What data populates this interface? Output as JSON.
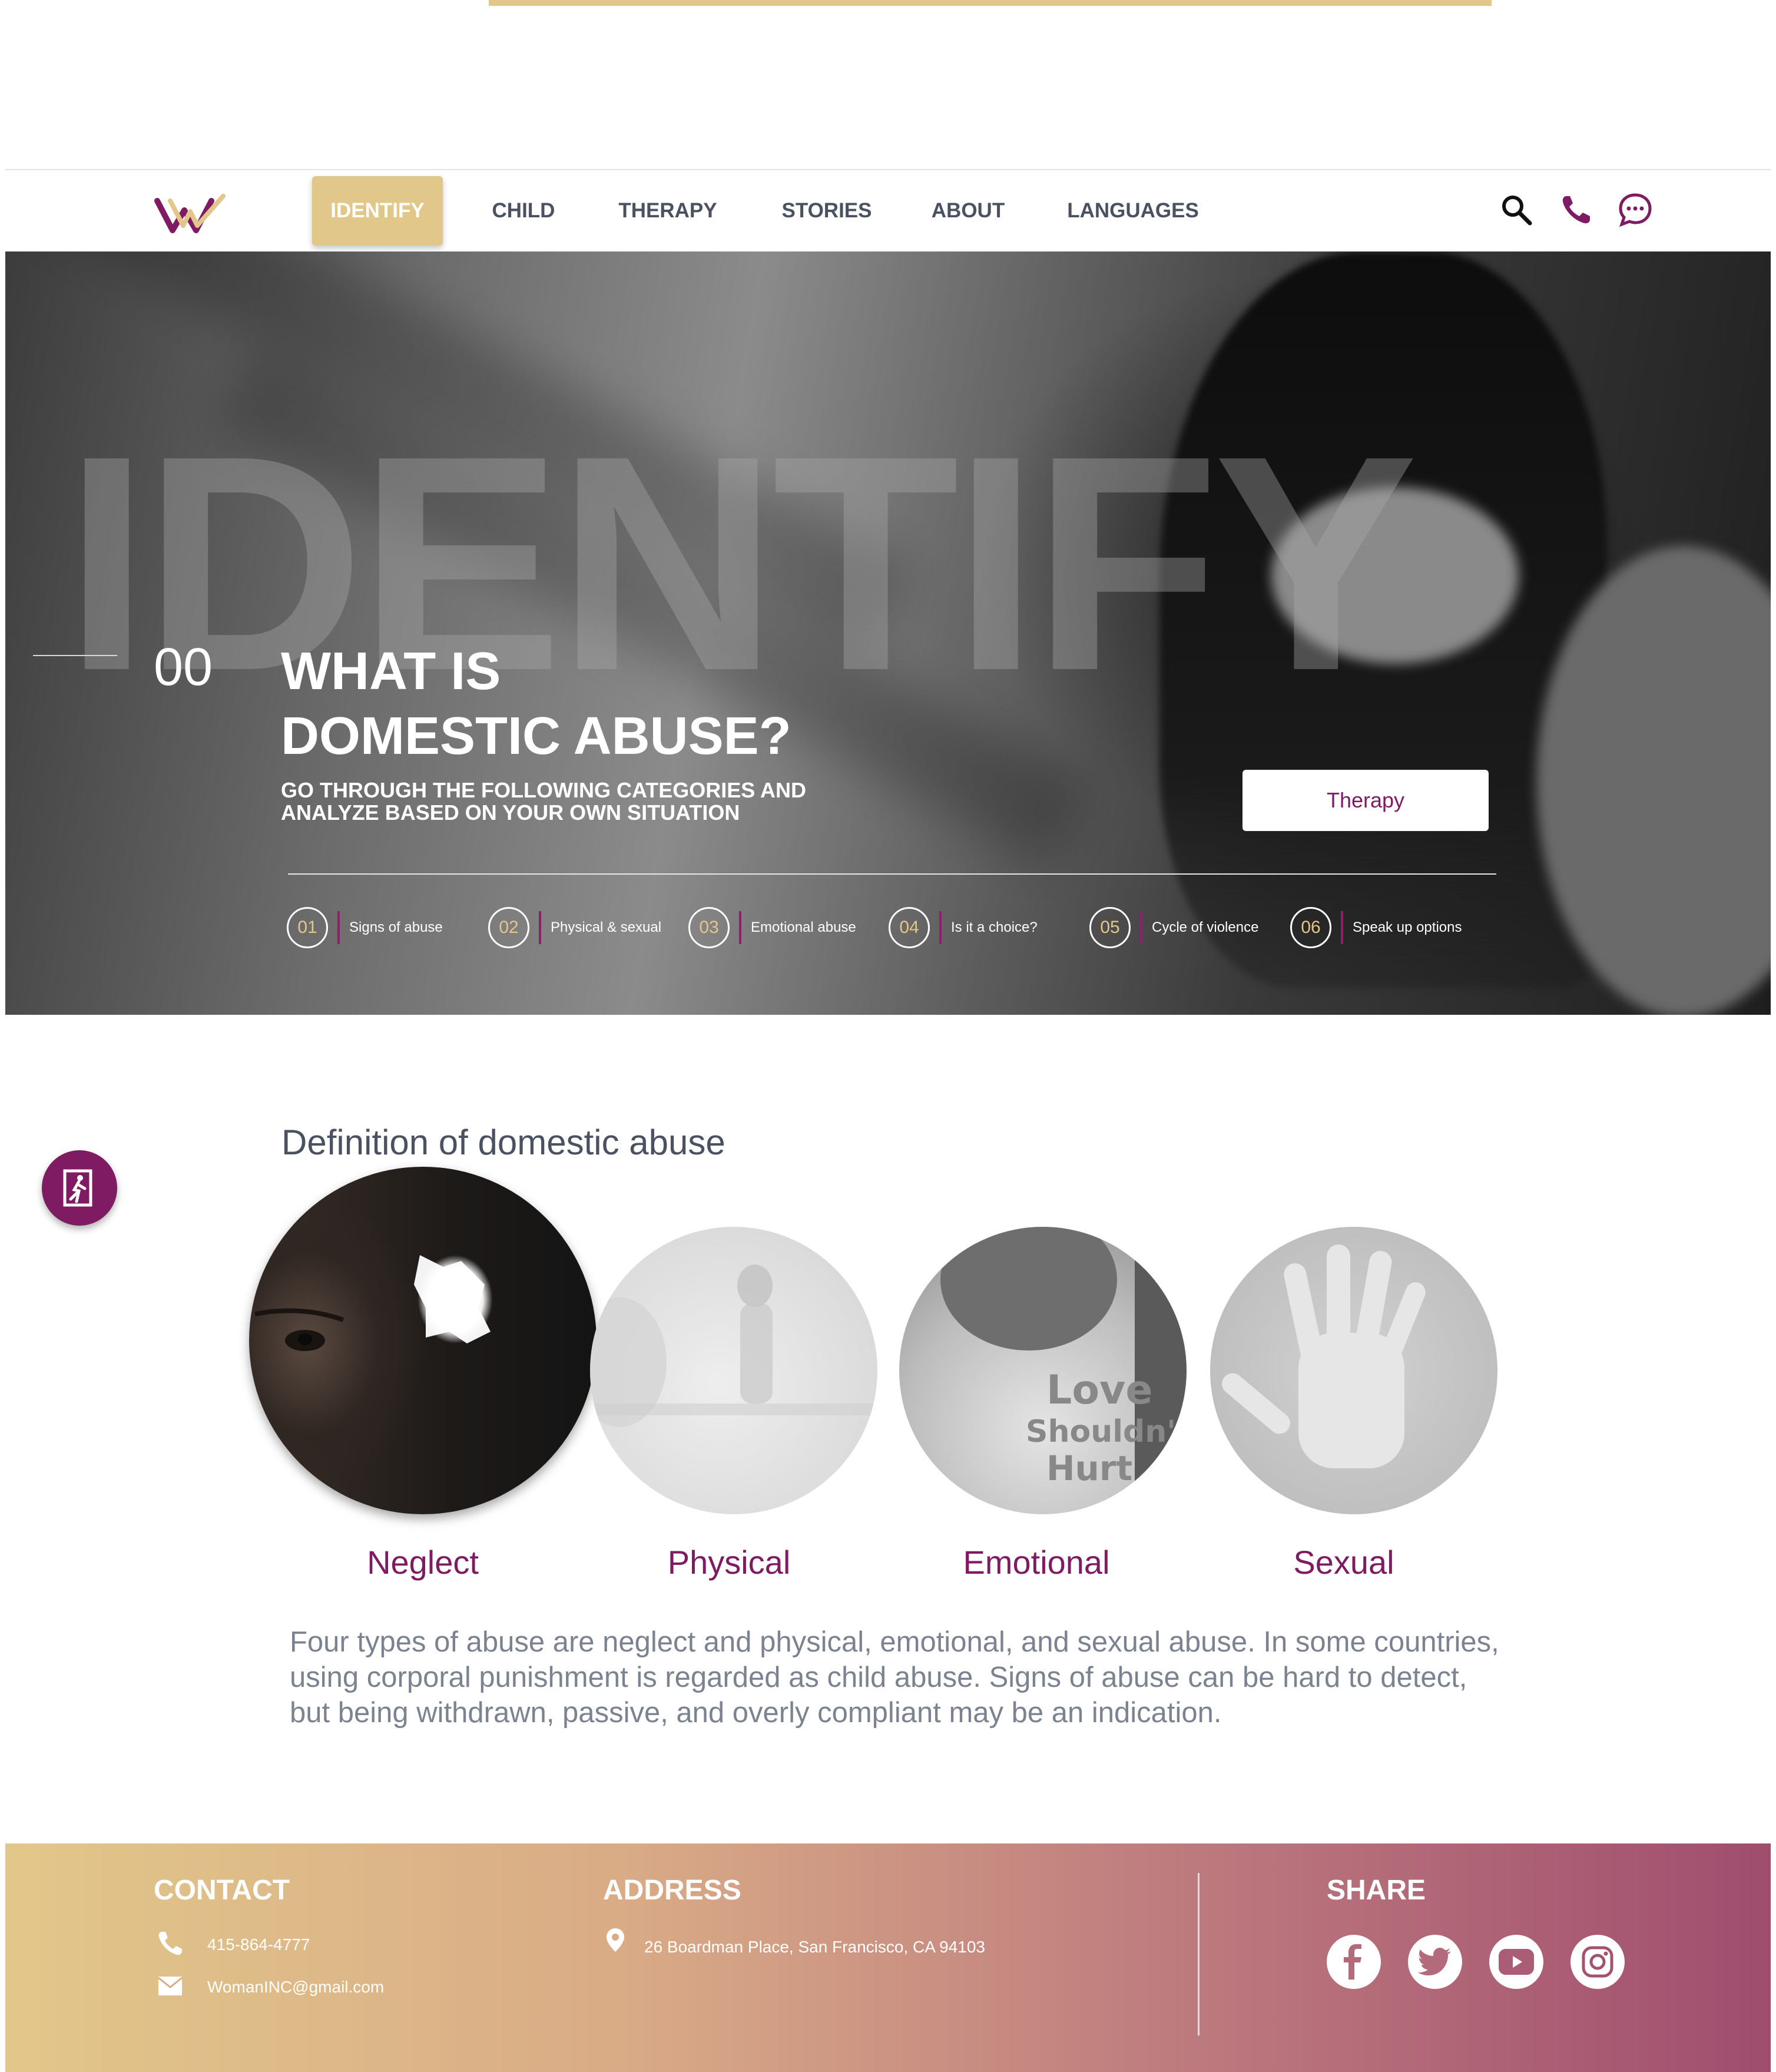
{
  "nav": {
    "items": [
      {
        "label": "IDENTIFY",
        "active": true
      },
      {
        "label": "CHILD",
        "active": false
      },
      {
        "label": "THERAPY",
        "active": false
      },
      {
        "label": "STORIES",
        "active": false
      },
      {
        "label": "ABOUT",
        "active": false
      },
      {
        "label": "LANGUAGES",
        "active": false
      }
    ],
    "icons": [
      "search-icon",
      "phone-icon",
      "chat-icon"
    ]
  },
  "hero": {
    "background_word": "IDENTIFY",
    "number": "00",
    "title_line1": "WHAT IS",
    "title_line2": "DOMESTIC ABUSE?",
    "subtitle_line1": "GO THROUGH THE FOLLOWING CATEGORIES AND",
    "subtitle_line2": "ANALYZE BASED ON YOUR OWN SITUATION",
    "button_label": "Therapy",
    "categories": [
      {
        "num": "01",
        "label": "Signs of abuse"
      },
      {
        "num": "02",
        "label": "Physical & sexual"
      },
      {
        "num": "03",
        "label": "Emotional abuse"
      },
      {
        "num": "04",
        "label": "Is it a choice?"
      },
      {
        "num": "05",
        "label": "Cycle of violence"
      },
      {
        "num": "06",
        "label": "Speak up options"
      }
    ]
  },
  "definition": {
    "title": "Definition of domestic abuse",
    "types": [
      {
        "label": "Neglect",
        "active": true
      },
      {
        "label": "Physical",
        "active": false
      },
      {
        "label": "Emotional",
        "active": false
      },
      {
        "label": "Sexual",
        "active": false
      }
    ],
    "emotional_image_text": [
      "Love",
      "Shouldn't",
      "Hurt"
    ],
    "paragraph": "Four types of abuse are neglect and physical, emotional, and sexual abuse. In some countries, using corporal punishment is regarded as child abuse. Signs of abuse can be hard to detect, but being withdrawn, passive, and overly compliant may be an indication."
  },
  "footer": {
    "contact": {
      "heading": "CONTACT",
      "phone": "415-864-4777",
      "email": "WomanINC@gmail.com"
    },
    "address": {
      "heading": "ADDRESS",
      "text": "26 Boardman Place, San Francisco, CA 94103"
    },
    "share": {
      "heading": "SHARE",
      "icons": [
        "facebook-icon",
        "twitter-icon",
        "youtube-icon",
        "instagram-icon"
      ]
    }
  },
  "colors": {
    "gold": "#e2c78a",
    "purple": "#7e1b62",
    "slate": "#4a5261",
    "gray_text": "#7c8390"
  }
}
